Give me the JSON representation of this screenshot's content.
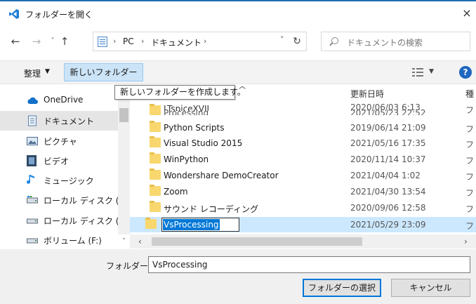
{
  "window": {
    "title": "フォルダーを開く",
    "close": "×",
    "icon": "vscode-icon",
    "accent": "#1f6fb2"
  },
  "nav": {
    "back": "←",
    "forward": "→",
    "recent": "˅",
    "up": "↑",
    "refresh": "↻"
  },
  "address": {
    "crumbs": [
      "PC",
      "ドキュメント"
    ],
    "sep": "›",
    "dropdown": "˅"
  },
  "search": {
    "placeholder": "ドキュメントの検索"
  },
  "toolbar": {
    "organize": "整理",
    "organize_caret": "▼",
    "new_folder": "新しいフォルダー",
    "view_caret": "▼",
    "help": "?"
  },
  "tooltip": "新しいフォルダーを作成します。",
  "sidebar": {
    "items": [
      {
        "label": "OneDrive",
        "icon": "cloud-icon"
      },
      {
        "label": "ドキュメント",
        "icon": "document-icon",
        "selected": true
      },
      {
        "label": "ピクチャ",
        "icon": "pictures-icon"
      },
      {
        "label": "ビデオ",
        "icon": "video-icon"
      },
      {
        "label": "ミュージック",
        "icon": "music-icon"
      },
      {
        "label": "ローカル ディスク (C",
        "icon": "drive-icon"
      },
      {
        "label": "ローカル ディスク (D",
        "icon": "drive-icon"
      },
      {
        "label": "ボリューム (F:)",
        "icon": "drive-icon"
      }
    ]
  },
  "columns": {
    "date": "更新日時",
    "type": "種"
  },
  "peek": {
    "name1": "LTspiceXVII",
    "date1": "2020/06/03 6:13",
    "name2": "Processing",
    "date2": "2021/05/23 22:52",
    "type": "フ"
  },
  "files": [
    {
      "name": "Python Scripts",
      "date": "2019/06/14 21:09",
      "type": "フ"
    },
    {
      "name": "Visual Studio 2015",
      "date": "2021/05/16 17:35",
      "type": "フ"
    },
    {
      "name": "WinPython",
      "date": "2020/11/14 10:37",
      "type": "フ"
    },
    {
      "name": "Wondershare DemoCreator",
      "date": "2021/04/04 1:02",
      "type": "フ"
    },
    {
      "name": "Zoom",
      "date": "2021/04/30 13:54",
      "type": "フ"
    },
    {
      "name": "サウンド レコーディング",
      "date": "2020/09/06 12:58",
      "type": "フ"
    }
  ],
  "editing": {
    "name": "VsProcessing",
    "date": "2021/05/29 23:09",
    "type": "フ"
  },
  "scroll": {
    "left": "‹",
    "right": "›",
    "down": "˅"
  },
  "folder_field": {
    "label": "フォルダー:",
    "value": "VsProcessing"
  },
  "buttons": {
    "select": "フォルダーの選択",
    "cancel": "キャンセル"
  }
}
